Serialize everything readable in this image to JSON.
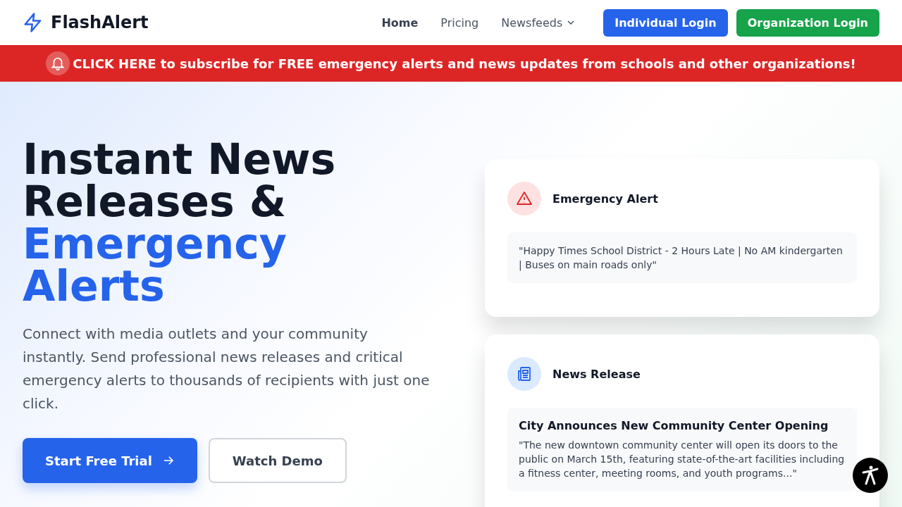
{
  "header": {
    "brand": "FlashAlert",
    "nav": [
      {
        "label": "Home",
        "selected": true,
        "kind": "link"
      },
      {
        "label": "Pricing",
        "selected": false,
        "kind": "link"
      },
      {
        "label": "Newsfeeds",
        "selected": false,
        "kind": "dropdown"
      }
    ],
    "buttons": [
      {
        "label": "Individual Login",
        "color": "#2563eb"
      },
      {
        "label": "Organization Login",
        "color": "#16a34a"
      }
    ]
  },
  "banner": {
    "text": "CLICK HERE to subscribe for FREE emergency alerts and news updates from schools and other organizations!"
  },
  "hero": {
    "headline": "Instant News Releases &",
    "headline_highlight": "Emergency Alerts",
    "description": "Connect with media outlets and your community instantly. Send professional news releases and critical emergency alerts to thousands of recipients with just one click.",
    "primary_button": "Start Free Trial",
    "secondary_button": "Watch Demo"
  },
  "cards": [
    {
      "kind": "alert",
      "title": "Emergency Alert",
      "body": "\"Happy Times School District - 2 Hours Late | No AM kindergarten | Buses on main roads only\""
    },
    {
      "kind": "news",
      "title": "News Release",
      "headline": "City Announces New Community Center Opening",
      "body": "\"The new downtown community center will open its doors to the public on March 15th, featuring state-of-the-art facilities including a fitness center, meeting rooms, and youth programs...\""
    }
  ]
}
